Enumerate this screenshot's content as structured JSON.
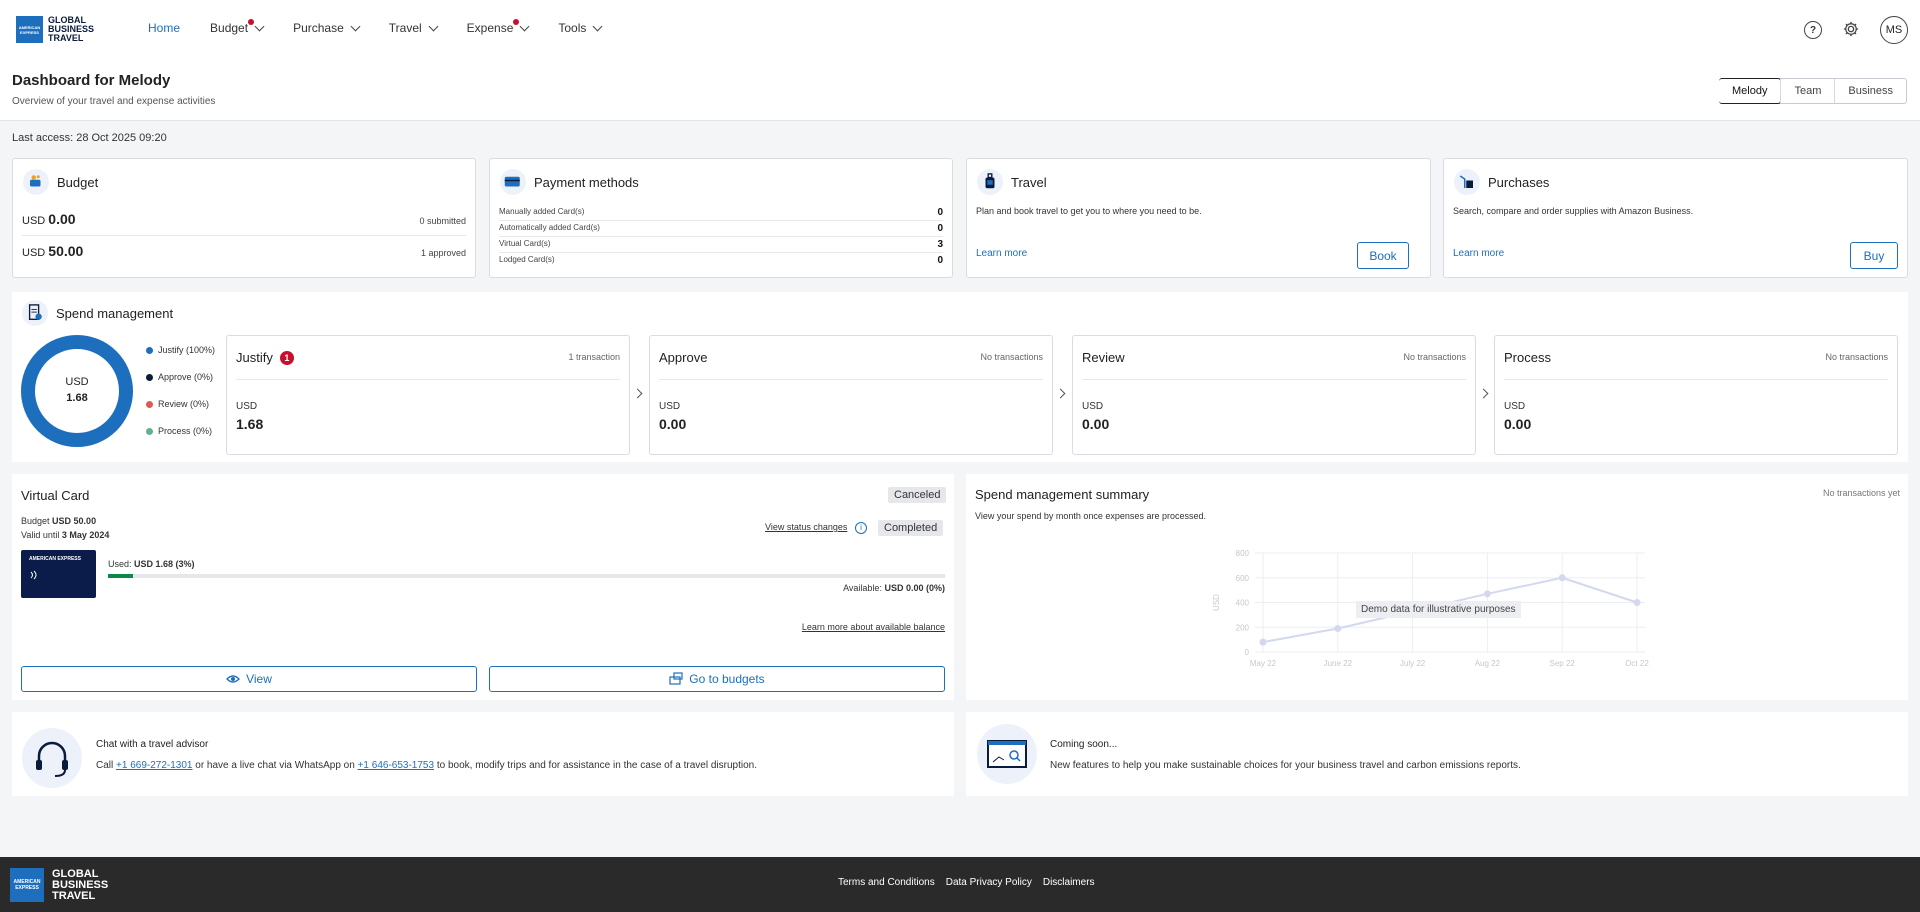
{
  "brand": {
    "logo_box": "AMERICAN EXPRESS",
    "logo_line1": "GLOBAL",
    "logo_line2": "BUSINESS",
    "logo_line3": "TRAVEL"
  },
  "nav": {
    "items": [
      {
        "label": "Home"
      },
      {
        "label": "Budget"
      },
      {
        "label": "Purchase"
      },
      {
        "label": "Travel"
      },
      {
        "label": "Expense"
      },
      {
        "label": "Tools"
      }
    ],
    "help_glyph": "?",
    "avatar_initials": "MS"
  },
  "page": {
    "title": "Dashboard for Melody",
    "subtitle": "Overview of your travel and expense activities",
    "last_access": "Last access: 28 Oct 2025 09:20",
    "view_tabs": [
      "Melody",
      "Team",
      "Business"
    ]
  },
  "budget_card": {
    "title": "Budget",
    "row1_currency": "USD",
    "row1_amount": "0.00",
    "row1_status": "0 submitted",
    "row2_currency": "USD",
    "row2_amount": "50.00",
    "row2_status": "1 approved"
  },
  "payment_card": {
    "title": "Payment methods",
    "rows": [
      {
        "label": "Manually added Card(s)",
        "value": "0"
      },
      {
        "label": "Automatically added Card(s)",
        "value": "0"
      },
      {
        "label": "Virtual Card(s)",
        "value": "3"
      },
      {
        "label": "Lodged Card(s)",
        "value": "0"
      }
    ]
  },
  "travel_card": {
    "title": "Travel",
    "text": "Plan and book travel to get you to where you need to be.",
    "link": "Learn more",
    "button": "Book"
  },
  "purchases_card": {
    "title": "Purchases",
    "text": "Search, compare and order supplies with Amazon Business.",
    "link": "Learn more",
    "button": "Buy"
  },
  "spend": {
    "title": "Spend management",
    "donut_currency": "USD",
    "donut_value": "1.68",
    "legend": [
      {
        "label": "Justify (100%)",
        "color": "#1d6fbe"
      },
      {
        "label": "Approve (0%)",
        "color": "#0b1b3a"
      },
      {
        "label": "Review (0%)",
        "color": "#e05a4f"
      },
      {
        "label": "Process (0%)",
        "color": "#5fb28a"
      }
    ],
    "steps": [
      {
        "title": "Justify",
        "badge": "1",
        "meta": "1 transaction",
        "currency": "USD",
        "value": "1.68"
      },
      {
        "title": "Approve",
        "badge": "",
        "meta": "No transactions",
        "currency": "USD",
        "value": "0.00"
      },
      {
        "title": "Review",
        "badge": "",
        "meta": "No transactions",
        "currency": "USD",
        "value": "0.00"
      },
      {
        "title": "Process",
        "badge": "",
        "meta": "No transactions",
        "currency": "USD",
        "value": "0.00"
      }
    ]
  },
  "virtual_card": {
    "title": "Virtual Card",
    "budget_prefix": "Budget",
    "budget_value": "USD 50.00",
    "valid_prefix": "Valid until",
    "valid_value": "3 May 2024",
    "status1": "Canceled",
    "status2": "Completed",
    "view_status_link": "View status changes",
    "card_brand": "AMERICAN EXPRESS",
    "used_prefix": "Used:",
    "used_value": "USD 1.68 (3%)",
    "used_fraction": 0.03,
    "available_prefix": "Available:",
    "available_value": "USD 0.00 (0%)",
    "learn_balance_link": "Learn more about available balance",
    "view_button": "View",
    "budgets_button": "Go to budgets"
  },
  "summary": {
    "title": "Spend management summary",
    "subtitle": "View your spend by month once expenses are processed.",
    "meta": "No transactions yet",
    "demo_label": "Demo data for illustrative purposes"
  },
  "chart_data": {
    "type": "line",
    "x": [
      "May 22",
      "June 22",
      "July 22",
      "Aug 22",
      "Sep 22",
      "Oct 22"
    ],
    "series": [
      {
        "values": [
          80,
          190,
          330,
          470,
          600,
          400
        ]
      }
    ],
    "ylabel": "USD",
    "y_ticks": [
      "0",
      "200",
      "400",
      "600",
      "800"
    ],
    "ylim": [
      0,
      800
    ],
    "grid": true
  },
  "advisor": {
    "title": "Chat with a travel advisor",
    "text_1": "Call",
    "phone_1": "+1 669-272-1301",
    "text_2": "or have a live chat via WhatsApp on",
    "phone_2": "+1 646-653-1753",
    "text_3": "to book, modify trips and for assistance in the case of a travel disruption."
  },
  "coming": {
    "title": "Coming soon...",
    "text": "New features to help you make sustainable choices for your business travel and carbon emissions reports."
  },
  "footer": {
    "links": [
      "Terms and Conditions",
      "Data Privacy Policy",
      "Disclaimers"
    ]
  },
  "colors": {
    "accent": "#1d6fbe",
    "alert": "#c8102e",
    "progress": "#0a8a4a",
    "footer_bg": "#2a2a2a"
  }
}
